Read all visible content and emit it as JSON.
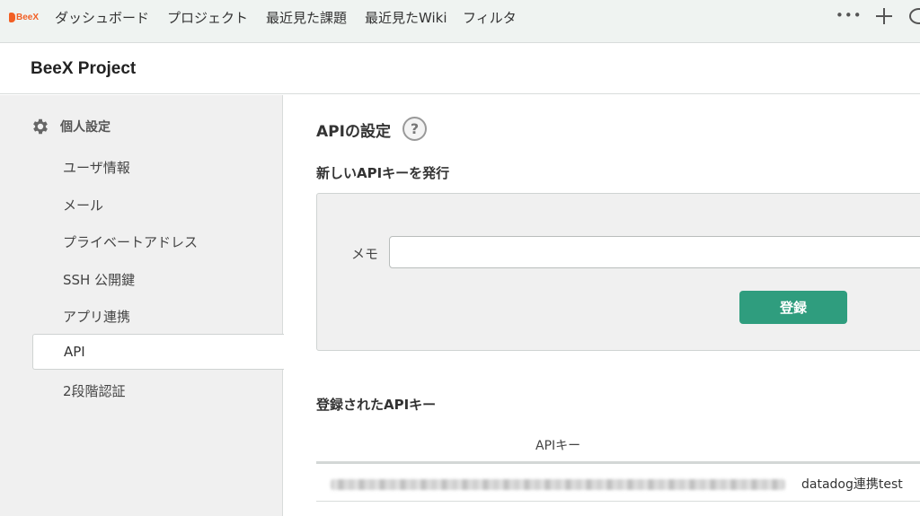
{
  "logo": {
    "text": "BeeX"
  },
  "nav": {
    "items": [
      {
        "label": "ダッシュボード"
      },
      {
        "label": "プロジェクト"
      },
      {
        "label": "最近見た課題"
      },
      {
        "label": "最近見たWiki"
      },
      {
        "label": "フィルタ"
      }
    ],
    "more_label": "•••"
  },
  "project": {
    "title": "BeeX Project"
  },
  "sidebar": {
    "heading": "個人設定",
    "items": [
      {
        "label": "ユーザ情報"
      },
      {
        "label": "メール"
      },
      {
        "label": "プライベートアドレス"
      },
      {
        "label": "SSH 公開鍵"
      },
      {
        "label": "アプリ連携"
      },
      {
        "label": "API",
        "active": true
      },
      {
        "label": "2段階認証"
      }
    ]
  },
  "main": {
    "title": "APIの設定",
    "help": "?",
    "new_key_heading": "新しいAPIキーを発行",
    "memo_label": "メモ",
    "memo_value": "",
    "register_button": "登録",
    "registered_heading": "登録されたAPIキー",
    "table": {
      "col_key": "APIキー",
      "rows": [
        {
          "memo": "datadog連携test"
        }
      ]
    }
  },
  "colors": {
    "accent": "#2f9d7e",
    "nav_bg": "#eff3f1",
    "logo": "#f25f24"
  }
}
